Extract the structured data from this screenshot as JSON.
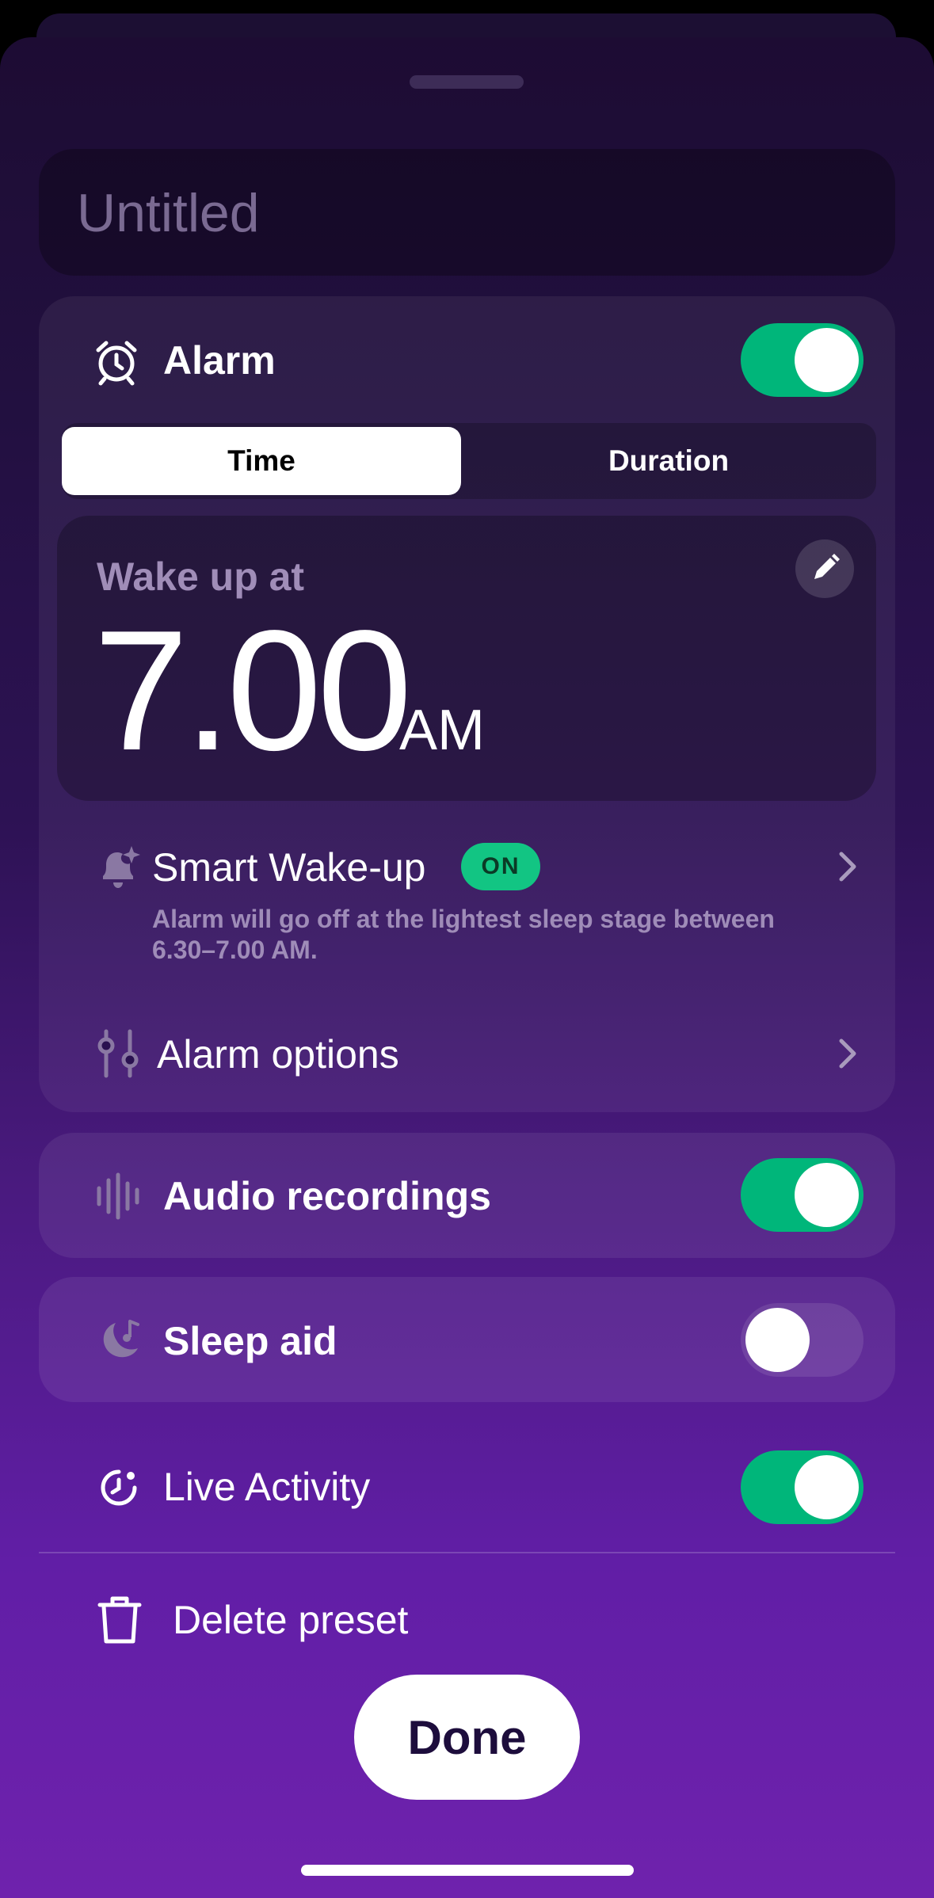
{
  "preset": {
    "title_placeholder": "Untitled"
  },
  "alarm": {
    "label": "Alarm",
    "enabled": true,
    "mode_tabs": [
      "Time",
      "Duration"
    ],
    "selected_mode": "Time",
    "wake_label": "Wake up at",
    "time": "7.00",
    "period": "AM",
    "smart_wakeup": {
      "label": "Smart Wake-up",
      "badge": "ON",
      "description": "Alarm will go off at the lightest sleep stage between 6.30–7.00 AM."
    },
    "options_label": "Alarm options"
  },
  "audio_recordings": {
    "label": "Audio recordings",
    "enabled": true
  },
  "sleep_aid": {
    "label": "Sleep aid",
    "enabled": false
  },
  "live_activity": {
    "label": "Live Activity",
    "enabled": true
  },
  "delete_label": "Delete preset",
  "done_label": "Done",
  "colors": {
    "accent_toggle": "#00b67a",
    "badge": "#12c583",
    "background_top": "#1d0c33",
    "background_bottom": "#6f22ad"
  }
}
